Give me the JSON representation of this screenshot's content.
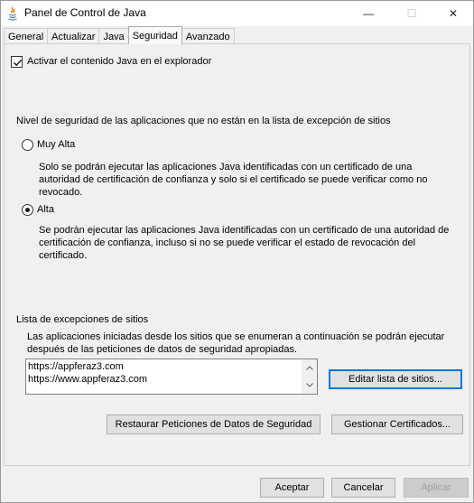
{
  "window": {
    "title": "Panel de Control de Java",
    "minimize_glyph": "—",
    "maximize_glyph": "☐",
    "close_glyph": "✕"
  },
  "tabs": [
    {
      "label": "General"
    },
    {
      "label": "Actualizar"
    },
    {
      "label": "Java"
    },
    {
      "label": "Seguridad",
      "active": true
    },
    {
      "label": "Avanzado"
    }
  ],
  "security": {
    "enable_java_label": "Activar el contenido Java en el explorador",
    "enable_java_checked": true,
    "level_heading": "Nivel de seguridad de las aplicaciones que no están en la lista de excepción de sitios",
    "levels": [
      {
        "label": "Muy Alta",
        "selected": false,
        "description": "Solo se podrán ejecutar las aplicaciones Java identificadas con un certificado de una autoridad de certificación de confianza y solo si el certificado se puede verificar como no revocado."
      },
      {
        "label": "Alta",
        "selected": true,
        "description": "Se podrán ejecutar las aplicaciones Java identificadas con un certificado de una autoridad de certificación de confianza, incluso si no se puede verificar el estado de revocación del certificado."
      }
    ],
    "exceptions_heading": "Lista de excepciones de sitios",
    "exceptions_description": "Las aplicaciones iniciadas desde los sitios que se enumeran a continuación se podrán ejecutar después de las peticiones de datos de seguridad apropiadas.",
    "sites": [
      "https://appferaz3.com",
      "https://www.appferaz3.com"
    ],
    "edit_sites_button": "Editar lista de sitios...",
    "restore_prompts_button": "Restaurar Peticiones de Datos de Seguridad",
    "manage_certs_button": "Gestionar Certificados..."
  },
  "footer": {
    "ok_button": "Aceptar",
    "cancel_button": "Cancelar",
    "apply_button": "Aplicar",
    "apply_enabled": false
  },
  "colors": {
    "focus_border": "#0078d7",
    "window_bg": "#f0f0f0",
    "button_bg": "#e1e1e1",
    "disabled_text": "#a0a0a0"
  }
}
